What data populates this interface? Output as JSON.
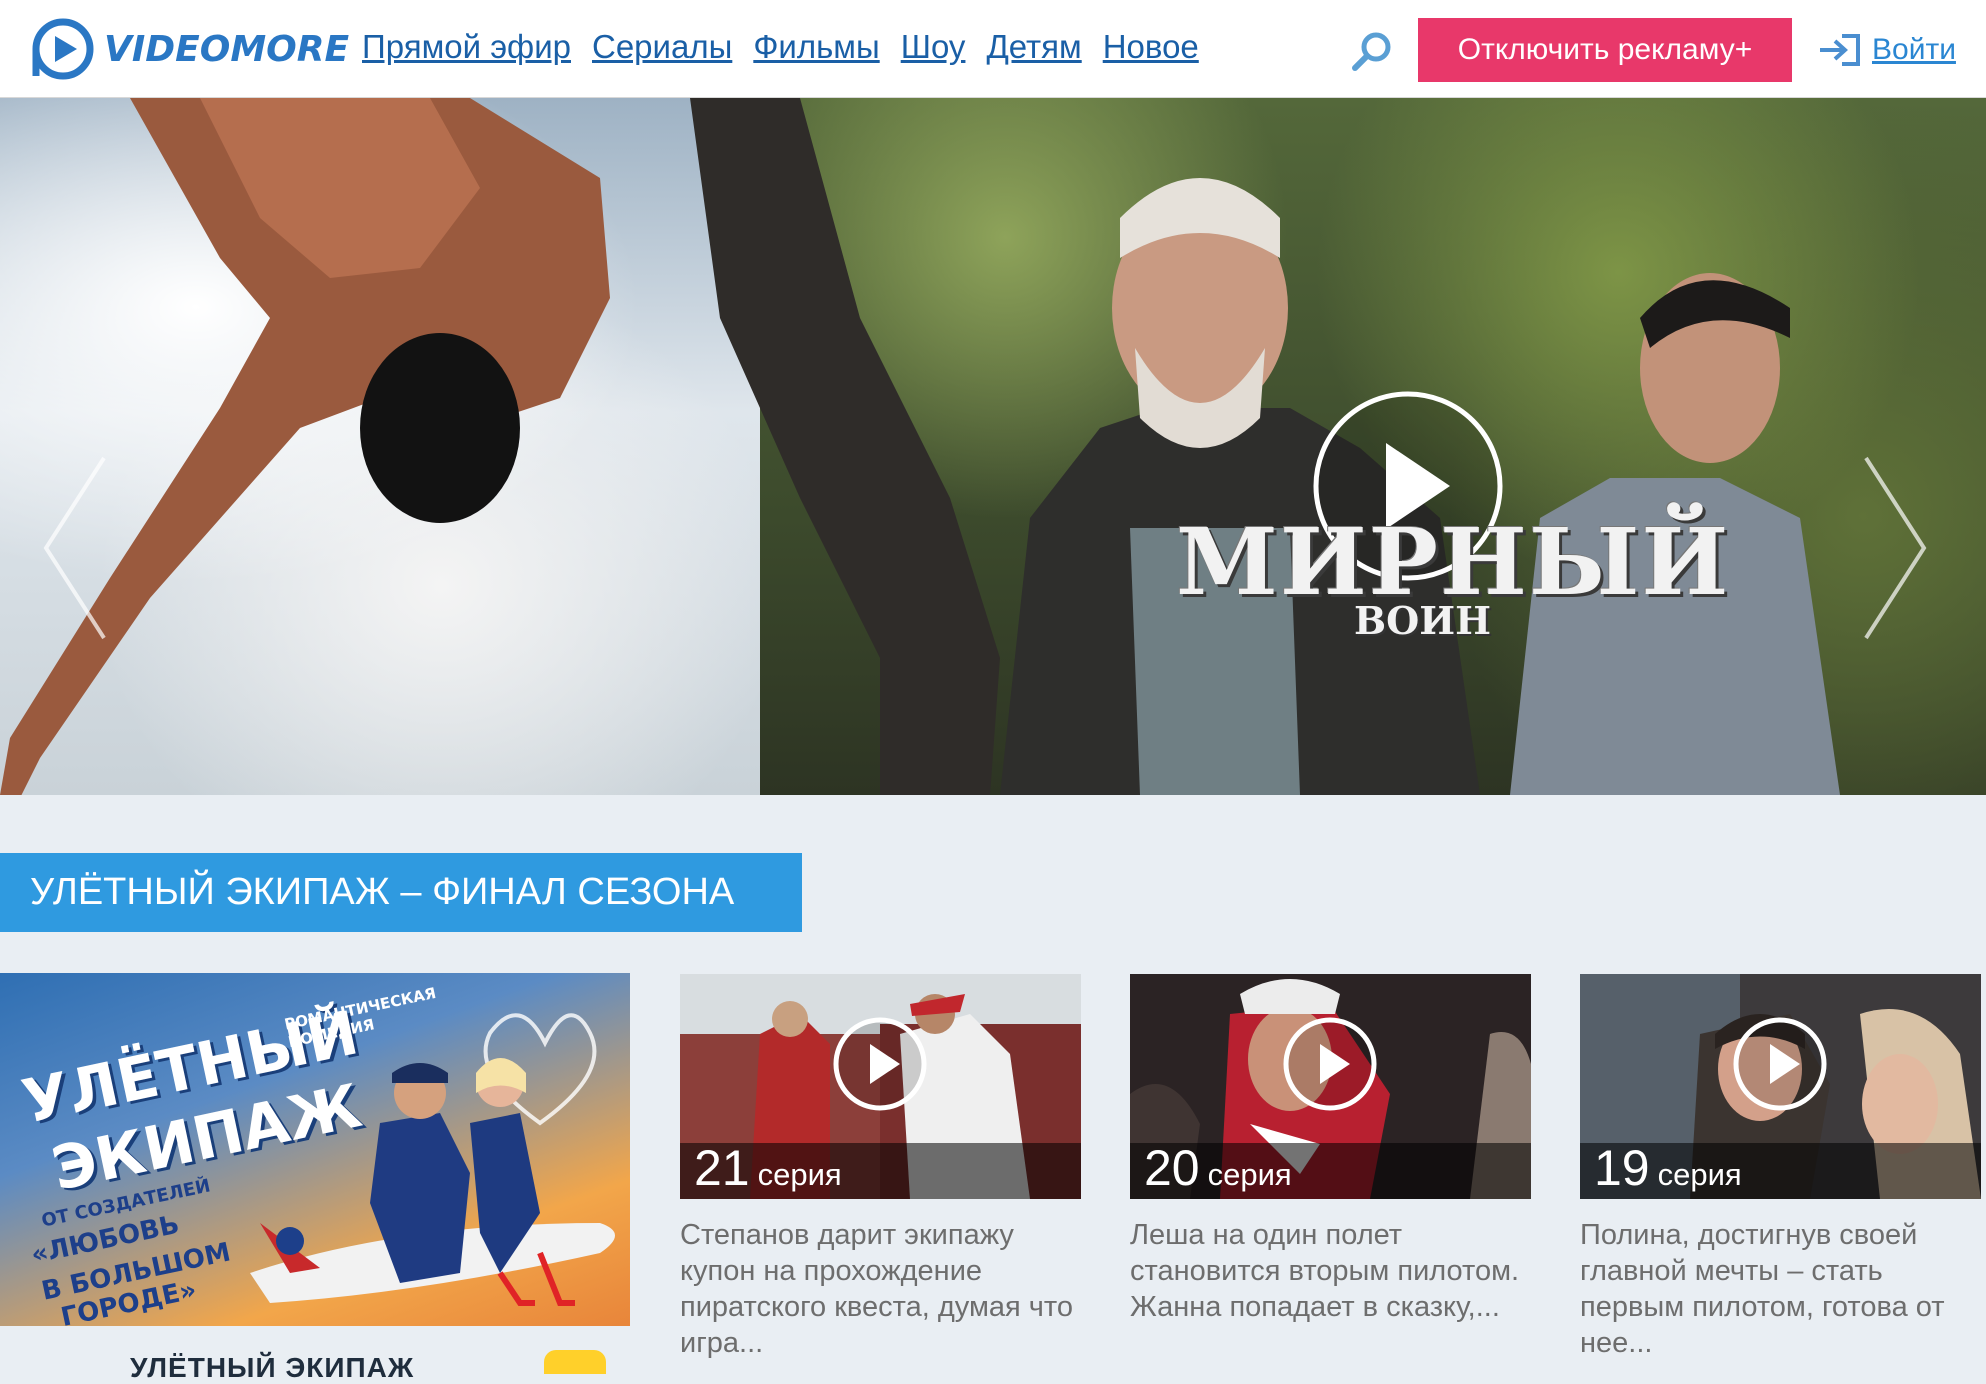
{
  "header": {
    "logo_text": "VIDEOMORE",
    "nav": [
      "Прямой эфир",
      "Сериалы",
      "Фильмы",
      "Шоу",
      "Детям",
      "Новое"
    ],
    "no_ads_label": "Отключить рекламу+",
    "login_label": "Войти"
  },
  "hero": {
    "title": "МИРНЫЙ",
    "subtitle": "ВОИН",
    "slides_total": 5,
    "active_slide": 2
  },
  "section": {
    "title": "УЛЁТНЫЙ ЭКИПАЖ – ФИНАЛ СЕЗОНА",
    "poster": {
      "line1": "УЛЁТНЫЙ",
      "line2": "ЭКИПАЖ",
      "genre": "РОМАНТИЧЕСКАЯ КОМЕДИЯ",
      "creators1": "ОТ СОЗДАТЕЛЕЙ",
      "creators2": "«ЛЮБОВЬ",
      "creators3": "В БОЛЬШОМ",
      "creators4": "ГОРОДЕ»",
      "caption": "УЛЁТНЫЙ ЭКИПАЖ"
    },
    "episodes": [
      {
        "number": "21",
        "label": "серия",
        "description": "Степанов дарит экипажу купон на прохождение пиратского квеста, думая что игра..."
      },
      {
        "number": "20",
        "label": "серия",
        "description": "Леша на один полет становится вторым пилотом. Жанна попадает в сказку,..."
      },
      {
        "number": "19",
        "label": "серия",
        "description": "Полина, достигнув своей главной мечты – стать первым пилотом, готова от нее..."
      }
    ]
  },
  "colors": {
    "accent_blue": "#2f9ae0",
    "brand_blue": "#2a77c4",
    "no_ads_pink": "#e8386a"
  }
}
